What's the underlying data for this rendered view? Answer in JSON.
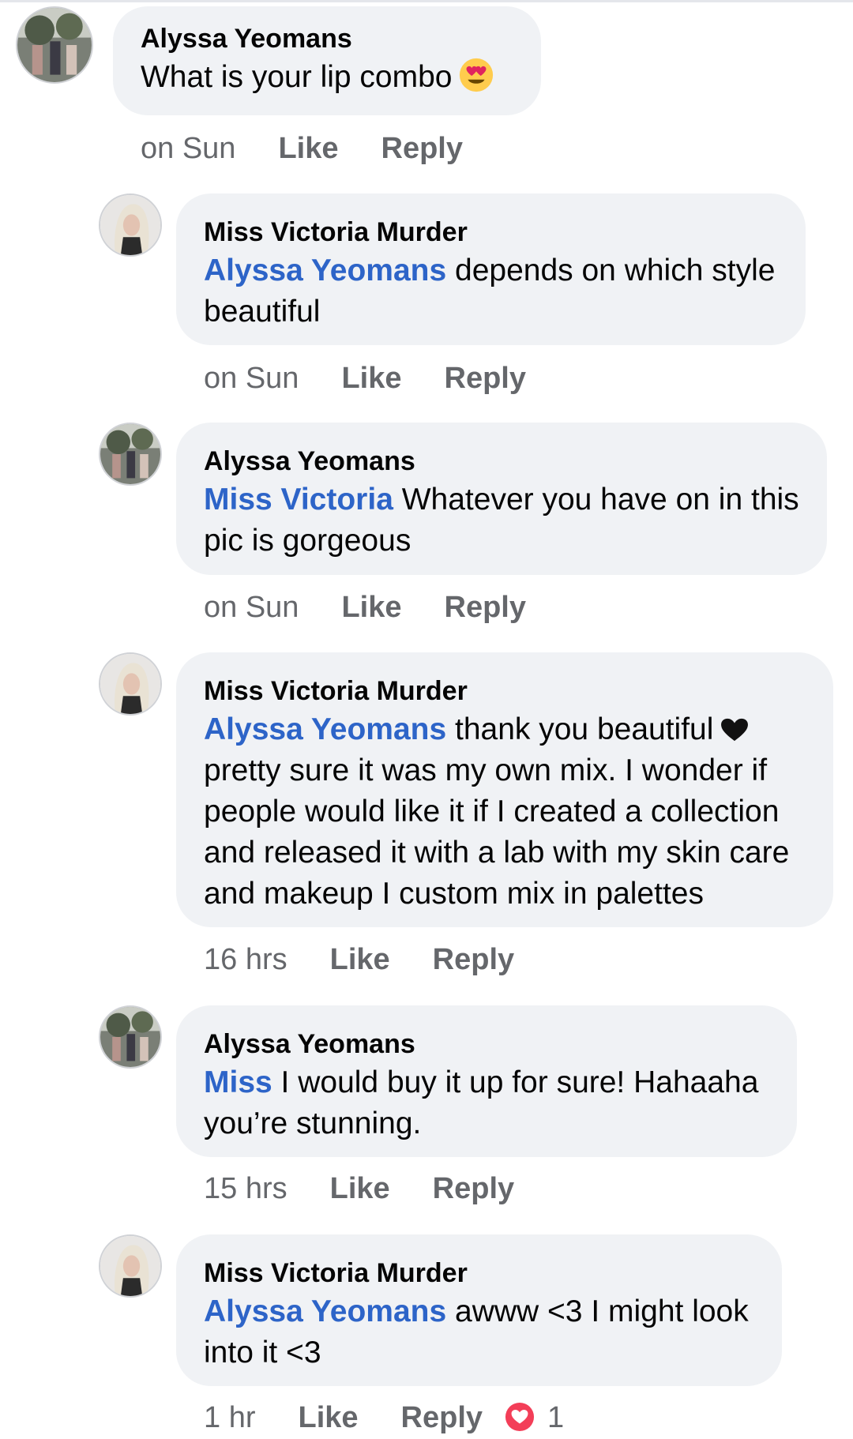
{
  "comments": [
    {
      "author": "Alyssa Yeomans",
      "mention": "",
      "text": "What is your lip combo",
      "time": "on Sun",
      "like": "Like",
      "reply": "Reply"
    },
    {
      "author": "Miss Victoria Murder",
      "mention": "Alyssa Yeomans",
      "text": "depends on which style beautiful",
      "time": "on Sun",
      "like": "Like",
      "reply": "Reply"
    },
    {
      "author": "Alyssa Yeomans",
      "mention": "Miss Victoria",
      "text": "Whatever you have on in this pic is gorgeous",
      "time": "on Sun",
      "like": "Like",
      "reply": "Reply"
    },
    {
      "author": "Miss Victoria Murder",
      "mention": "Alyssa Yeomans",
      "text": "thank you beautiful",
      "text2": "pretty sure it was my own mix. I wonder if people would like it if I created a collection and released it with a lab with my skin care and makeup I custom mix in palettes",
      "time": "16 hrs",
      "like": "Like",
      "reply": "Reply"
    },
    {
      "author": "Alyssa Yeomans",
      "mention": "Miss",
      "text": "I would buy it up for sure! Hahaaha you’re stunning.",
      "time": "15 hrs",
      "like": "Like",
      "reply": "Reply"
    },
    {
      "author": "Miss Victoria Murder",
      "mention": "Alyssa Yeomans",
      "text": "awww <3 I might look into it <3",
      "time": "1 hr",
      "like": "Like",
      "reply": "Reply",
      "reaction_icon": "love-reaction-icon",
      "reaction_count": "1"
    }
  ],
  "colors": {
    "mention": "#2d64c8",
    "bubble": "#f0f2f5",
    "meta": "#65676b",
    "love_reaction": "#f33e58"
  }
}
